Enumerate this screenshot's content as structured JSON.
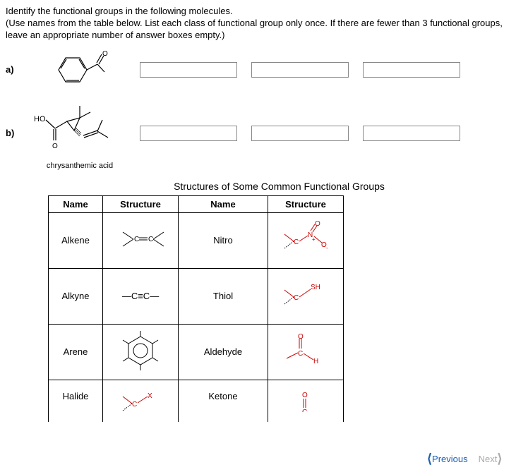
{
  "instructions": "Identify the functional groups in the following molecules.\n(Use names from the table below. List each class of functional group only once. If there are fewer than 3 functional groups, leave an appropriate number of answer boxes empty.)",
  "questions": {
    "a": {
      "label": "a)",
      "caption": ""
    },
    "b": {
      "label": "b)",
      "caption": "chrysanthemic acid",
      "atom_label": "HO"
    }
  },
  "table": {
    "title": "Structures of Some Common Functional Groups",
    "headers": {
      "name1": "Name",
      "struct1": "Structure",
      "name2": "Name",
      "struct2": "Structure"
    },
    "rows": [
      {
        "name1": "Alkene",
        "name2": "Nitro"
      },
      {
        "name1": "Alkyne",
        "name2": "Thiol"
      },
      {
        "name1": "Arene",
        "name2": "Aldehyde"
      },
      {
        "name1": "Halide",
        "name2": "Ketone"
      }
    ],
    "labels": {
      "sh": "SH",
      "h": "H",
      "o": "O",
      "x": "X",
      "alkyne_text": "C≡C"
    }
  },
  "nav": {
    "previous": "Previous",
    "next": "Next"
  }
}
